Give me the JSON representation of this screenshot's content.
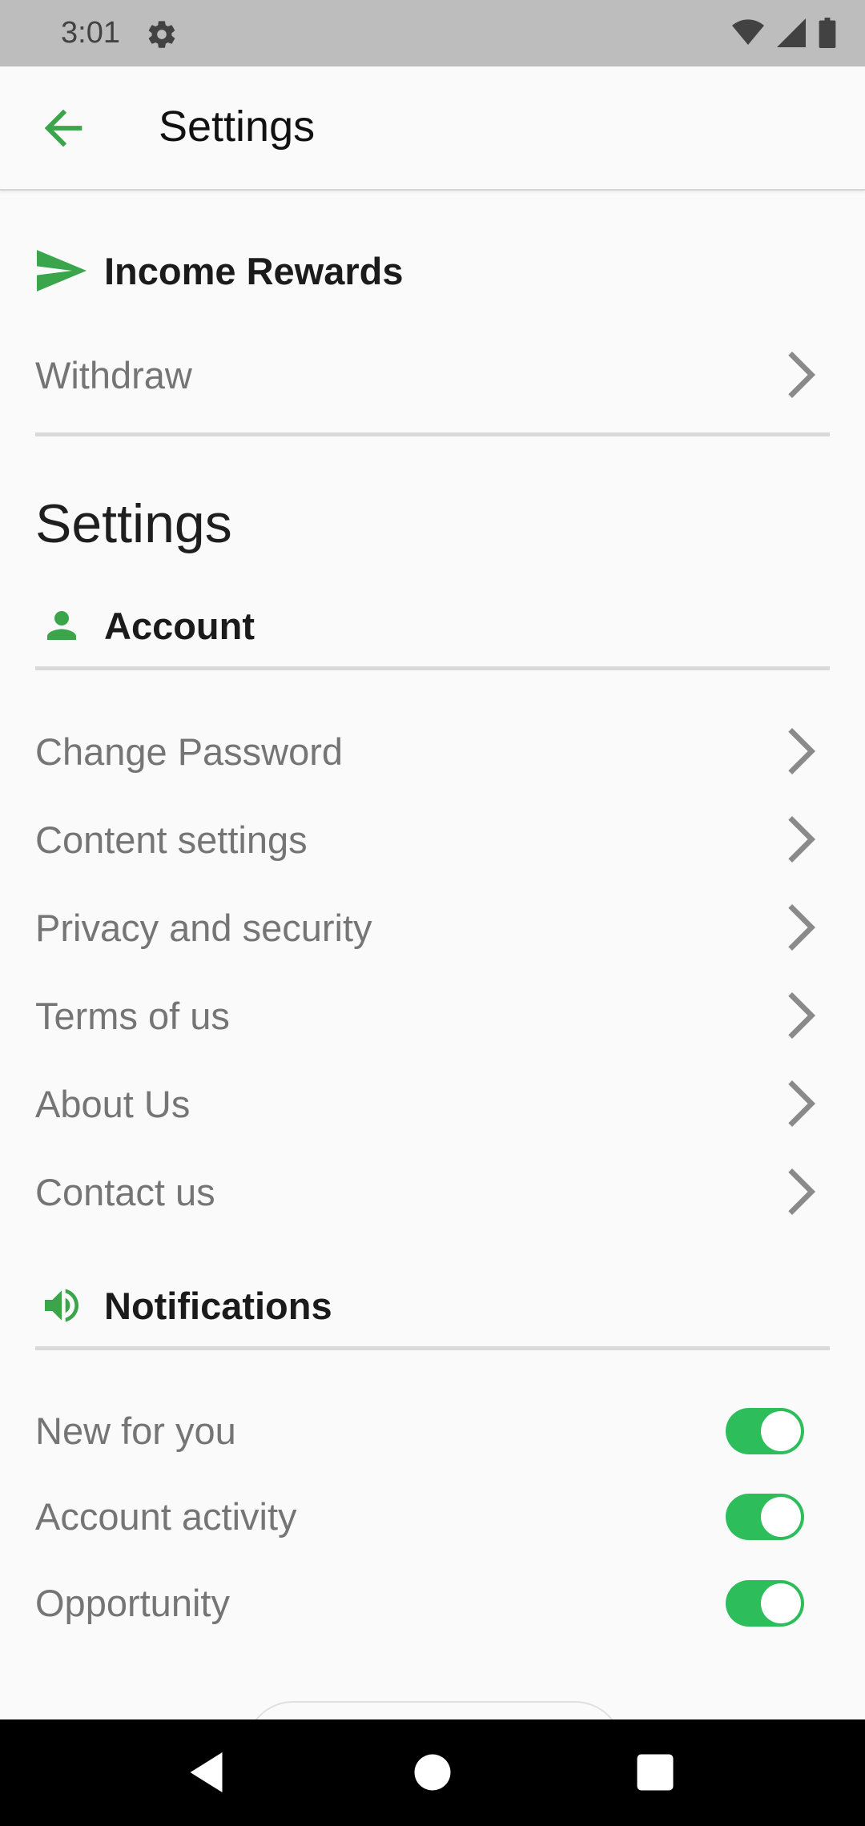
{
  "status_bar": {
    "time": "3:01"
  },
  "app_bar": {
    "title": "Settings"
  },
  "income_rewards": {
    "header": "Income Rewards",
    "items": [
      {
        "label": "Withdraw"
      }
    ]
  },
  "settings_title": "Settings",
  "account": {
    "header": "Account",
    "items": [
      {
        "label": "Change Password"
      },
      {
        "label": "Content settings"
      },
      {
        "label": "Privacy and security"
      },
      {
        "label": "Terms of us"
      },
      {
        "label": "About Us"
      },
      {
        "label": "Contact us"
      }
    ]
  },
  "notifications": {
    "header": "Notifications",
    "items": [
      {
        "label": "New for you",
        "enabled": true
      },
      {
        "label": "Account activity",
        "enabled": true
      },
      {
        "label": "Opportunity",
        "enabled": true
      }
    ]
  },
  "colors": {
    "accent": "#3aa54a",
    "toggle_on": "#2dbd5b",
    "muted_text": "#757575"
  }
}
